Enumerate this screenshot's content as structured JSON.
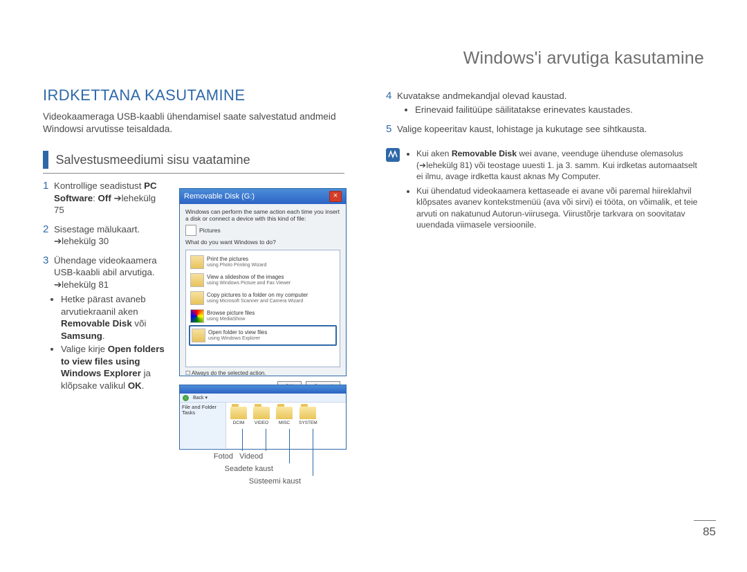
{
  "page": {
    "title": "Windows'i arvutiga kasutamine",
    "section_title": "IRDKETTANA KASUTAMINE",
    "intro": "Videokaameraga USB-kaabli ühendamisel saate salvestatud andmeid Windowsi arvutisse teisaldada.",
    "subheading": "Salvestusmeediumi sisu vaatamine",
    "page_number": "85"
  },
  "steps_left": {
    "s1": {
      "num": "1",
      "text_a": "Kontrollige seadistust ",
      "b1": "PC Software",
      "text_b": ": ",
      "b2": "Off",
      "text_c": " ➔lehekülg 75"
    },
    "s2": {
      "num": "2",
      "text": "Sisestage mälukaart. ➔lehekülg 30"
    },
    "s3": {
      "num": "3",
      "text": "Ühendage videokaamera USB-kaabli abil arvutiga. ➔lehekülg 81",
      "b1_a": "Hetke pärast avaneb arvutiekraanil aken ",
      "b1_b": "Removable Disk",
      "b1_c": " või ",
      "b1_d": "Samsung",
      "b1_e": ".",
      "b2_a": "Valige kirje ",
      "b2_b": "Open folders to view files using Windows Explorer",
      "b2_c": " ja klõpsake valikul ",
      "b2_d": "OK",
      "b2_e": "."
    }
  },
  "steps_right": {
    "s4": {
      "num": "4",
      "text": "Kuvatakse andmekandjal olevad kaustad.",
      "bullet": "Erinevaid failitüüpe säilitatakse erinevates kaustades."
    },
    "s5": {
      "num": "5",
      "text": "Valige kopeeritav kaust, lohistage ja kukutage see sihtkausta."
    }
  },
  "note": {
    "b1_a": "Kui aken ",
    "b1_b": "Removable Disk",
    "b1_c": " wei avane, veenduge ühenduse olemasolus (➔lehekülg 81) või teostage uuesti 1. ja 3. samm. Kui irdketas automaatselt ei ilmu, avage irdketta kaust aknas My Computer.",
    "b2": "Kui ühendatud videokaamera kettaseade ei avane või paremal hiireklahvil klõpsates avanev kontekstmenüü (ava või sirvi) ei tööta, on võimalik, et teie arvuti on nakatunud Autorun-viirusega. Viirustõrje tarkvara on soovitatav uuendada viimasele versioonile."
  },
  "shot1": {
    "title": "Removable Disk (G:)",
    "line1": "Windows can perform the same action each time you insert a disk or connect a device with this kind of file:",
    "pictures": "Pictures",
    "q": "What do you want Windows to do?",
    "opts": {
      "o1": {
        "t": "Print the pictures",
        "s": "using Photo Printing Wizard"
      },
      "o2": {
        "t": "View a slideshow of the images",
        "s": "using Windows Picture and Fax Viewer"
      },
      "o3": {
        "t": "Copy pictures to a folder on my computer",
        "s": "using Microsoft Scanner and Camera Wizard"
      },
      "o4": {
        "t": "Browse picture files",
        "s": "using MediaShow"
      },
      "o5": {
        "t": "Open folder to view files",
        "s": "using Windows Explorer"
      }
    },
    "chk": "Always do the selected action.",
    "ok": "OK",
    "cancel": "Cancel"
  },
  "shot2": {
    "folders": [
      "DCIM",
      "VIDEO",
      "MISC",
      "SYSTEM"
    ]
  },
  "callouts": {
    "c1": "Fotod",
    "c2": "Videod",
    "c3": "Seadete kaust",
    "c4": "Süsteemi kaust"
  }
}
